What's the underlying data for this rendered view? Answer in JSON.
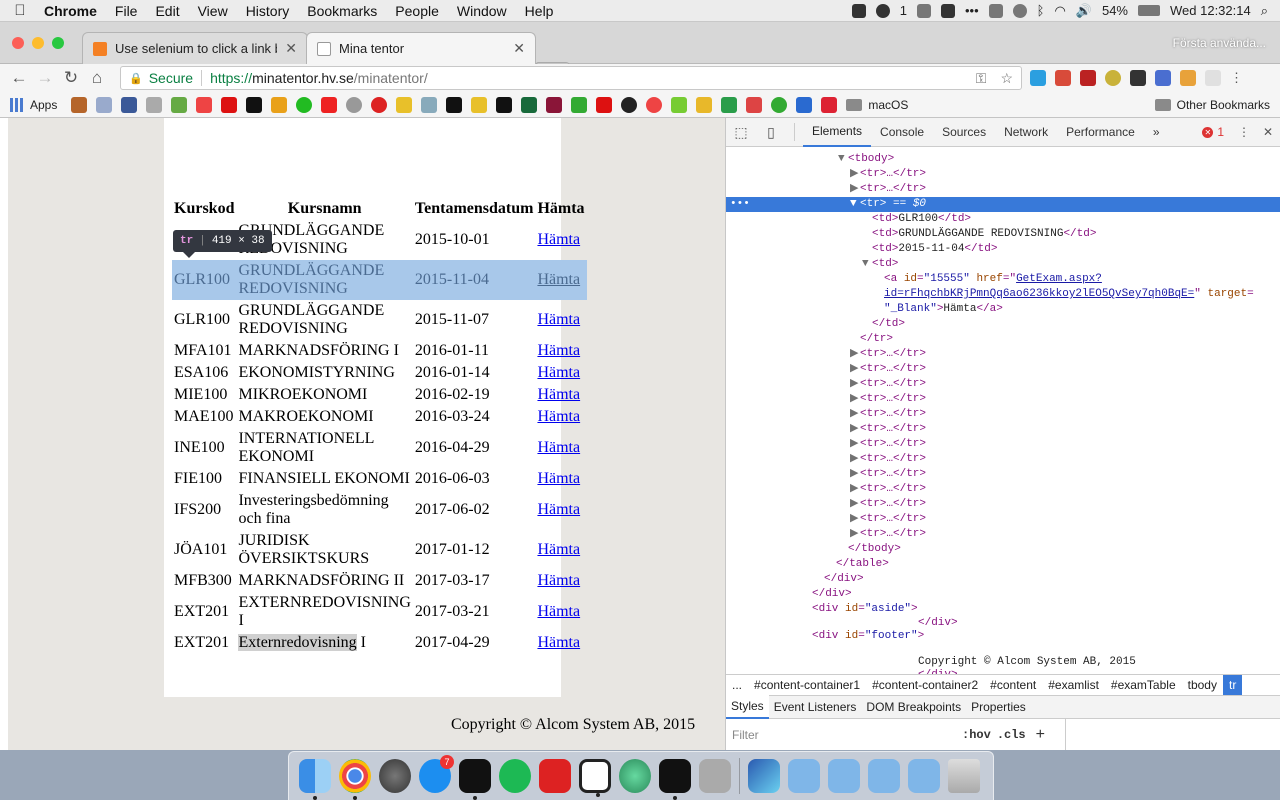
{
  "menubar": {
    "app_name": "Chrome",
    "items": [
      "File",
      "Edit",
      "View",
      "History",
      "Bookmarks",
      "People",
      "Window",
      "Help"
    ],
    "notification_count": "1",
    "battery": "54%",
    "clock": "Wed 12:32:14"
  },
  "browser": {
    "tabs": [
      {
        "title": "Use selenium to click a link ba",
        "active": false
      },
      {
        "title": "Mina tentor",
        "active": true
      }
    ],
    "profile_name": "Första använda...",
    "url": {
      "scheme": "https://",
      "host": "minatentor.hv.se",
      "path": "/minatentor/",
      "secure_label": "Secure"
    },
    "bookmarks": {
      "apps_label": "Apps",
      "folder_macos": "macOS",
      "other": "Other Bookmarks"
    }
  },
  "page": {
    "headers": {
      "code": "Kurskod",
      "name": "Kursnamn",
      "date": "Tentamensdatum",
      "fetch": "Hämta"
    },
    "rows": [
      {
        "code": "",
        "name": "GRUNDLÄGGANDE REDOVISNING",
        "date": "2015-10-01",
        "link": "Hämta"
      },
      {
        "code": "GLR100",
        "name": "GRUNDLÄGGANDE REDOVISNING",
        "date": "2015-11-04",
        "link": "Hämta"
      },
      {
        "code": "GLR100",
        "name": "GRUNDLÄGGANDE REDOVISNING",
        "date": "2015-11-07",
        "link": "Hämta"
      },
      {
        "code": "MFA101",
        "name": "MARKNADSFÖRING I",
        "date": "2016-01-11",
        "link": "Hämta"
      },
      {
        "code": "ESA106",
        "name": "EKONOMISTYRNING",
        "date": "2016-01-14",
        "link": "Hämta"
      },
      {
        "code": "MIE100",
        "name": "MIKROEKONOMI",
        "date": "2016-02-19",
        "link": "Hämta"
      },
      {
        "code": "MAE100",
        "name": "MAKROEKONOMI",
        "date": "2016-03-24",
        "link": "Hämta"
      },
      {
        "code": "INE100",
        "name": "INTERNATIONELL EKONOMI",
        "date": "2016-04-29",
        "link": "Hämta"
      },
      {
        "code": "FIE100",
        "name": "FINANSIELL EKONOMI",
        "date": "2016-06-03",
        "link": "Hämta"
      },
      {
        "code": "IFS200",
        "name": "Investeringsbedömning och fina",
        "date": "2017-06-02",
        "link": "Hämta"
      },
      {
        "code": "JÖA101",
        "name": "JURIDISK ÖVERSIKTSKURS",
        "date": "2017-01-12",
        "link": "Hämta"
      },
      {
        "code": "MFB300",
        "name": "MARKNADSFÖRING II",
        "date": "2017-03-17",
        "link": "Hämta"
      },
      {
        "code": "EXT201",
        "name": "EXTERNREDOVISNING I",
        "date": "2017-03-21",
        "link": "Hämta"
      },
      {
        "code": "EXT201",
        "name_highlight": "Externredovisning",
        "name_rest": " I",
        "date": "2017-04-29",
        "link": "Hämta"
      }
    ],
    "tooltip": {
      "tag": "tr",
      "size": "419 × 38"
    },
    "copyright": "Copyright © Alcom System AB, 2015"
  },
  "devtools": {
    "tabs": [
      "Elements",
      "Console",
      "Sources",
      "Network",
      "Performance"
    ],
    "more": "»",
    "error_count": "1",
    "dom": {
      "tbody_open": "<tbody>",
      "tr_collapsed": "<tr>…</tr>",
      "tr_selected": "<tr>",
      "selected_marker": "== $0",
      "td_code": "GLR100",
      "td_name": "GRUNDLÄGGANDE REDOVISNING",
      "td_date": "2015-11-04",
      "a_id": "\"15555\"",
      "a_href_1": "GetExam.aspx?",
      "a_href_2": "id=rFhqchbKRjPmnQq6ao6236kkoy2lEO5QvSey7qh0BqE=",
      "a_target": "\"_Blank\"",
      "a_text": "Hämta",
      "aside_id": "\"aside\"",
      "footer_id": "\"footer\"",
      "footer_text": "Copyright © Alcom System AB, 2015"
    },
    "breadcrumbs": [
      "...",
      "#content-container1",
      "#content-container2",
      "#content",
      "#examlist",
      "#examTable",
      "tbody",
      "tr"
    ],
    "side_tabs": [
      "Styles",
      "Event Listeners",
      "DOM Breakpoints",
      "Properties"
    ],
    "filter_placeholder": "Filter",
    "hov": ":hov",
    "cls": ".cls",
    "plus": "+"
  }
}
